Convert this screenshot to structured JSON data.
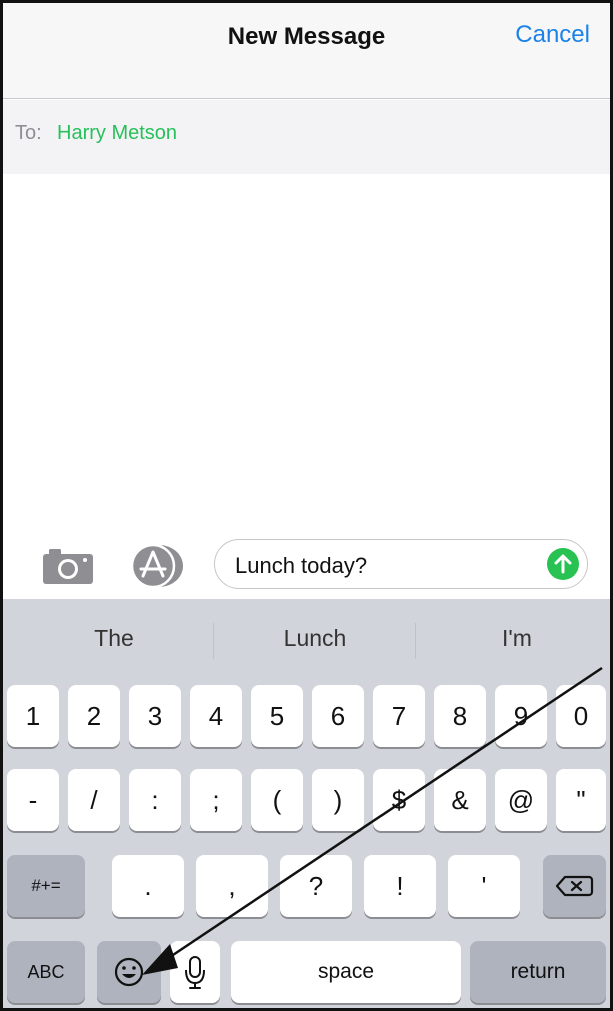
{
  "header": {
    "title": "New Message",
    "cancel_label": "Cancel"
  },
  "recipient": {
    "to_label": "To:",
    "name": "Harry Metson"
  },
  "composer": {
    "text": "Lunch today?"
  },
  "suggestions": [
    "The",
    "Lunch",
    "I'm"
  ],
  "keyboard": {
    "row1": [
      "1",
      "2",
      "3",
      "4",
      "5",
      "6",
      "7",
      "8",
      "9",
      "0"
    ],
    "row2": [
      "-",
      "/",
      ":",
      ";",
      "(",
      ")",
      "$",
      "&",
      "@",
      "\""
    ],
    "row3": {
      "toggle_label": "#+=",
      "keys": [
        ".",
        ",",
        "?",
        "!",
        "'"
      ]
    },
    "row4": {
      "abc_label": "ABC",
      "space_label": "space",
      "return_label": "return"
    }
  },
  "colors": {
    "accent_blue": "#1a82e8",
    "recipient_green": "#28c05a",
    "send_green": "#27c251",
    "keyboard_bg": "#d1d4da"
  },
  "icons": [
    "camera-icon",
    "app-store-icon",
    "send-arrow-icon",
    "emoji-icon",
    "microphone-icon",
    "delete-icon"
  ]
}
